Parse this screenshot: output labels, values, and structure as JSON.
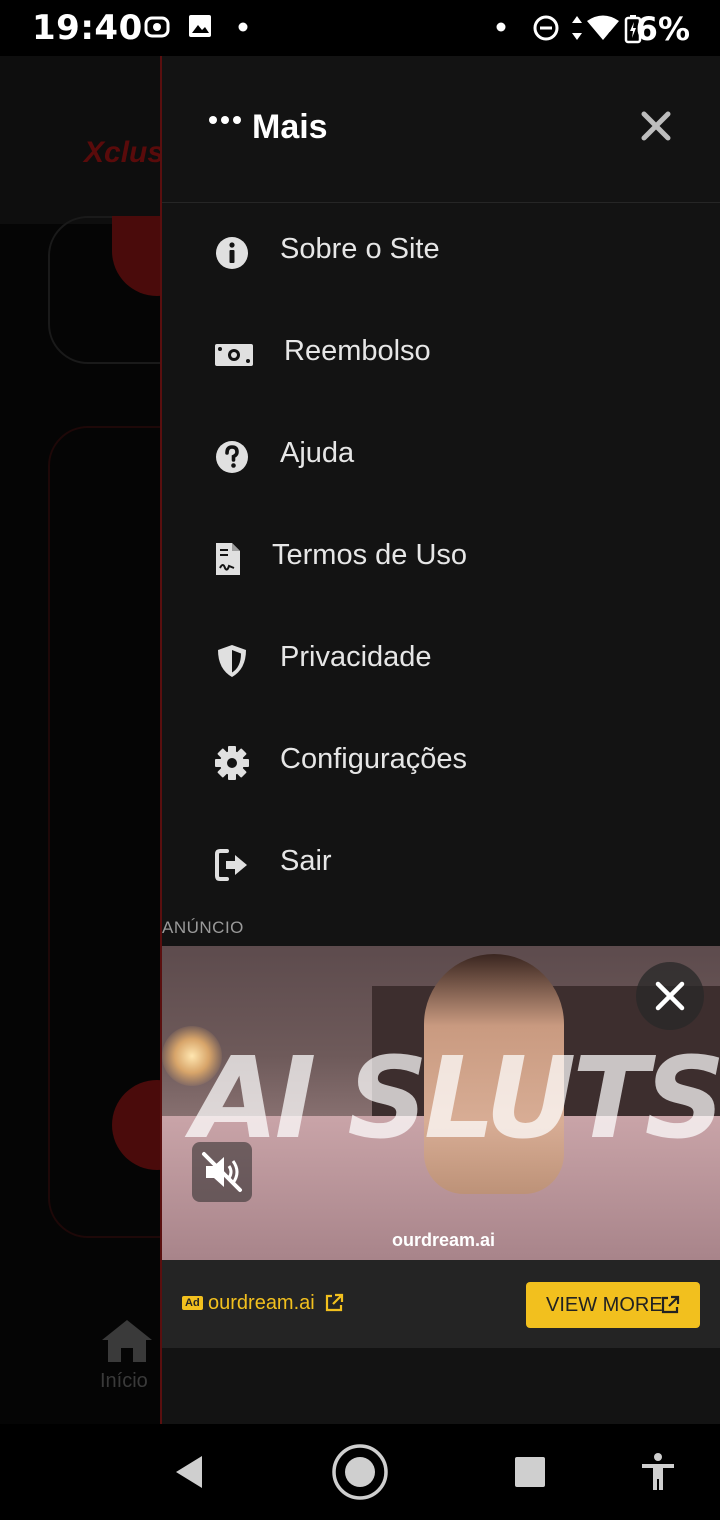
{
  "status_bar": {
    "time": "19:40",
    "battery": "6%",
    "icons": [
      "screen-record-icon",
      "image-icon",
      "notification-dot-icon",
      "dot-icon",
      "do-not-disturb-icon",
      "data-arrows-icon",
      "wifi-icon",
      "battery-charging-icon"
    ]
  },
  "background_app": {
    "logo": "Xclus",
    "nav_home_label": "Início"
  },
  "drawer": {
    "title": "Mais",
    "items": [
      {
        "label": "Sobre o Site",
        "icon": "info-icon"
      },
      {
        "label": "Reembolso",
        "icon": "money-bill-icon"
      },
      {
        "label": "Ajuda",
        "icon": "question-icon"
      },
      {
        "label": "Termos de Uso",
        "icon": "file-contract-icon"
      },
      {
        "label": "Privacidade",
        "icon": "shield-icon"
      },
      {
        "label": "Configurações",
        "icon": "gear-icon"
      },
      {
        "label": "Sair",
        "icon": "sign-out-icon"
      }
    ]
  },
  "ad": {
    "section_label": "ANÚNCIO",
    "brand_text": "AI SLUTS",
    "watermark": "ourdream.ai",
    "badge": "Ad",
    "domain": "ourdream.ai",
    "cta": "VIEW MORE"
  },
  "colors": {
    "drawer_bg": "#131313",
    "accent_red": "#5a0f0f",
    "ad_cta": "#f2c01e"
  }
}
